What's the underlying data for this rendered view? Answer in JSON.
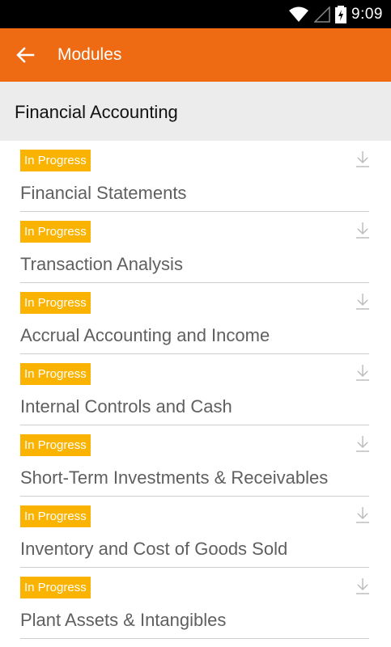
{
  "status_bar": {
    "time": "9:09",
    "icons": [
      "wifi-icon",
      "signal-icon",
      "battery-charging-icon"
    ]
  },
  "app_bar": {
    "title": "Modules",
    "background_color": "#ee6b13",
    "back_icon": "arrow-left-icon"
  },
  "section": {
    "title": "Financial Accounting"
  },
  "badge_color": "#f9b300",
  "modules": [
    {
      "status": "In Progress",
      "title": "Financial Statements"
    },
    {
      "status": "In Progress",
      "title": "Transaction Analysis"
    },
    {
      "status": "In Progress",
      "title": "Accrual Accounting and Income"
    },
    {
      "status": "In Progress",
      "title": "Internal Controls and Cash"
    },
    {
      "status": "In Progress",
      "title": "Short-Term Investments & Receivables"
    },
    {
      "status": "In Progress",
      "title": "Inventory and Cost of Goods Sold"
    },
    {
      "status": "In Progress",
      "title": "Plant Assets & Intangibles"
    }
  ]
}
